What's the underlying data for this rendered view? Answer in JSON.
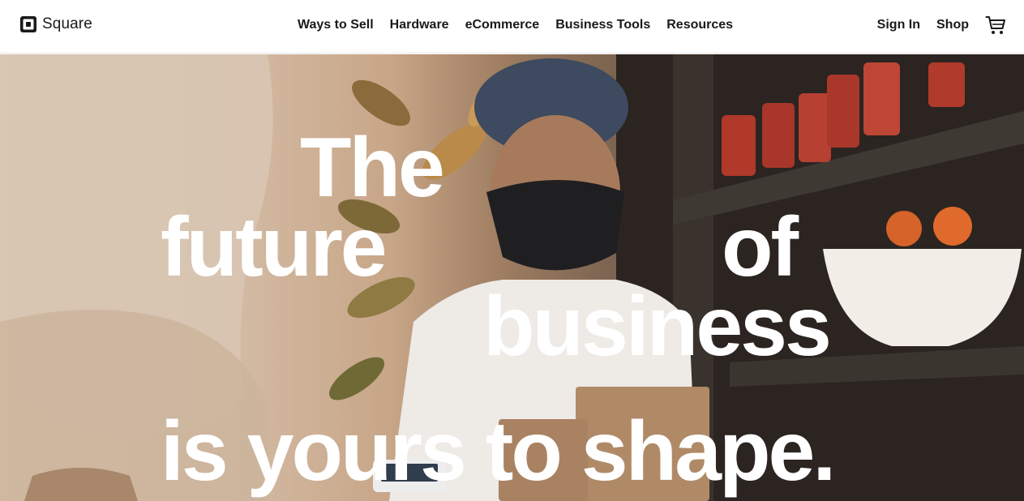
{
  "brand": {
    "name": "Square"
  },
  "nav": {
    "links": [
      "Ways to Sell",
      "Hardware",
      "eCommerce",
      "Business Tools",
      "Resources"
    ],
    "sign_in": "Sign In",
    "shop": "Shop",
    "cart_icon": "shopping-cart-icon"
  },
  "hero": {
    "headline": {
      "word_the": "The",
      "word_future": "future",
      "word_of": "of",
      "word_business": "business",
      "line_last": "is yours to shape."
    },
    "image": "woman-in-face-mask-holding-boxes-photo"
  },
  "colors": {
    "text_dark": "#1a1a1a",
    "headline_text": "#ffffff",
    "nav_background": "#ffffff"
  }
}
